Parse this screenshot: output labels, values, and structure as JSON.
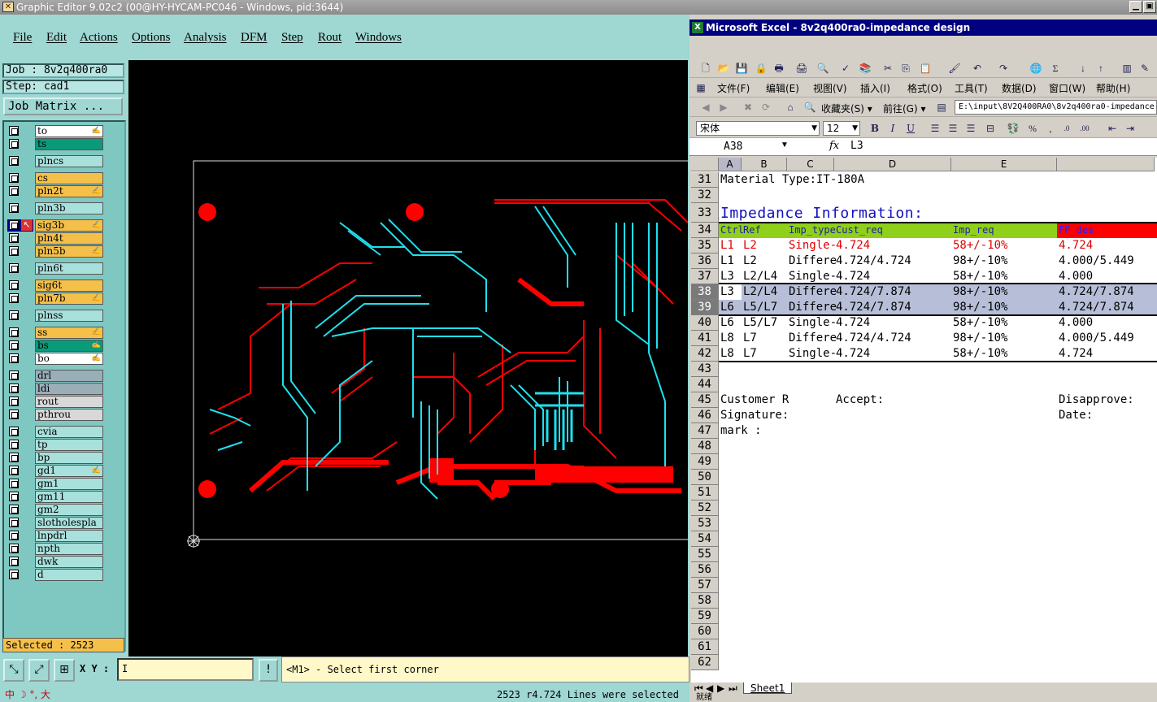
{
  "window": {
    "title": "Graphic Editor 9.02c2 (00@HY-HYCAM-PC046 - Windows, pid:3644)"
  },
  "menu": [
    "File",
    "Edit",
    "Actions",
    "Options",
    "Analysis",
    "DFM",
    "Step",
    "Rout",
    "Windows"
  ],
  "job": {
    "job": "Job : 8v2q400ra0",
    "step": "Step: cad1",
    "matrix": "Job Matrix ..."
  },
  "layers": [
    {
      "name": "to",
      "color": "#ffffff",
      "mark": "✍"
    },
    {
      "name": "ts",
      "color": "#0a9a7a",
      "mark": ""
    },
    {
      "name": "plncs",
      "color": "#a8e0dc",
      "mark": ""
    },
    {
      "name": "cs",
      "color": "#f5c04a",
      "mark": ""
    },
    {
      "name": "pln2t",
      "color": "#f5c04a",
      "mark": "✍"
    },
    {
      "name": "pln3b",
      "color": "#a8e0dc",
      "mark": ""
    },
    {
      "name": "sig3b",
      "color": "#f5c04a",
      "mark": "✍"
    },
    {
      "name": "pln4t",
      "color": "#f5c04a",
      "mark": ""
    },
    {
      "name": "pln5b",
      "color": "#f5c04a",
      "mark": "✍"
    },
    {
      "name": "pln6t",
      "color": "#a8e0dc",
      "mark": ""
    },
    {
      "name": "sig6t",
      "color": "#f5c04a",
      "mark": ""
    },
    {
      "name": "pln7b",
      "color": "#f5c04a",
      "mark": "✍"
    },
    {
      "name": "plnss",
      "color": "#a8e0dc",
      "mark": ""
    },
    {
      "name": "ss",
      "color": "#f5c04a",
      "mark": "✍"
    },
    {
      "name": "bs",
      "color": "#0a9a7a",
      "mark": "✍"
    },
    {
      "name": "bo",
      "color": "#ffffff",
      "mark": "✍"
    },
    {
      "name": "drl",
      "color": "#9aaeb8",
      "mark": ""
    },
    {
      "name": "ldi",
      "color": "#9aaeb8",
      "mark": ""
    },
    {
      "name": "rout",
      "color": "#d8d8d8",
      "mark": ""
    },
    {
      "name": "pthrou",
      "color": "#d8d8d8",
      "mark": ""
    },
    {
      "name": "cvia",
      "color": "#a8e0dc",
      "mark": ""
    },
    {
      "name": "tp",
      "color": "#a8e0dc",
      "mark": ""
    },
    {
      "name": "bp",
      "color": "#a8e0dc",
      "mark": ""
    },
    {
      "name": "gd1",
      "color": "#a8e0dc",
      "mark": "✍"
    },
    {
      "name": "gm1",
      "color": "#a8e0dc",
      "mark": ""
    },
    {
      "name": "gm11",
      "color": "#a8e0dc",
      "mark": ""
    },
    {
      "name": "gm2",
      "color": "#a8e0dc",
      "mark": ""
    },
    {
      "name": "slotholespla",
      "color": "#a8e0dc",
      "mark": ""
    },
    {
      "name": "lnpdrl",
      "color": "#a8e0dc",
      "mark": ""
    },
    {
      "name": "npth",
      "color": "#a8e0dc",
      "mark": ""
    },
    {
      "name": "dwk",
      "color": "#a8e0dc",
      "mark": ""
    },
    {
      "name": "d",
      "color": "#a8e0dc",
      "mark": ""
    }
  ],
  "selected": "Selected : 2523",
  "bottom": {
    "xy_label": "X Y :",
    "message": "<M1> - Select first corner",
    "status": "2523 r4.724 Lines were selected",
    "ime": "中 ☽ °, 大"
  },
  "excel": {
    "title": "Microsoft Excel - 8v2q400ra0-impedance design",
    "menu": [
      "文件(F)",
      "编辑(E)",
      "视图(V)",
      "插入(I)",
      "格式(O)",
      "工具(T)",
      "数据(D)",
      "窗口(W)",
      "帮助(H)"
    ],
    "web": {
      "favorites": "收藏夹(S) ▾",
      "go": "前往(G) ▾",
      "path": "E:\\input\\8V2Q400RA0\\8v2q400ra0-impedance"
    },
    "font": {
      "name": "宋体",
      "size": "12"
    },
    "namebox": "A38",
    "fx": "fx",
    "formula": "L3",
    "columns": [
      {
        "label": "A",
        "w": 28
      },
      {
        "label": "B",
        "w": 56
      },
      {
        "label": "C",
        "w": 58
      },
      {
        "label": "D",
        "w": 144
      },
      {
        "label": "E",
        "w": 130
      },
      {
        "label": "",
        "w": 120
      }
    ],
    "rows": [
      {
        "n": "31",
        "cells": [
          {
            "t": "Material Type:IT-180A",
            "c": 0
          }
        ]
      },
      {
        "n": "32",
        "cells": []
      },
      {
        "n": "33",
        "cells": [
          {
            "t": "Impedance Information:",
            "c": 0,
            "big": true
          }
        ]
      },
      {
        "n": "34",
        "cells": [
          {
            "t": "Ctrl",
            "c": 0
          },
          {
            "t": "Ref",
            "c": 1
          },
          {
            "t": "Imp_type",
            "c": 2
          },
          {
            "t": "Cust_req",
            "c": 3
          },
          {
            "t": "Imp_req",
            "c": 4
          },
          {
            "t": "FP_des",
            "c": 5
          }
        ],
        "hdr": true
      },
      {
        "n": "35",
        "cells": [
          {
            "t": "L1",
            "c": 0
          },
          {
            "t": "L2",
            "c": 1
          },
          {
            "t": "Single-",
            "c": 2
          },
          {
            "t": "4.724",
            "c": 3
          },
          {
            "t": "58+/-10%",
            "c": 4
          },
          {
            "t": "4.724",
            "c": 5
          }
        ],
        "red": true
      },
      {
        "n": "36",
        "cells": [
          {
            "t": "L1",
            "c": 0
          },
          {
            "t": "L2",
            "c": 1
          },
          {
            "t": "Differe",
            "c": 2
          },
          {
            "t": "4.724/4.724",
            "c": 3
          },
          {
            "t": "98+/-10%",
            "c": 4
          },
          {
            "t": "4.000/5.449",
            "c": 5
          }
        ]
      },
      {
        "n": "37",
        "cells": [
          {
            "t": "L3",
            "c": 0
          },
          {
            "t": "L2/L4",
            "c": 1
          },
          {
            "t": "Single-",
            "c": 2
          },
          {
            "t": "4.724",
            "c": 3
          },
          {
            "t": "58+/-10%",
            "c": 4
          },
          {
            "t": "4.000",
            "c": 5
          }
        ]
      },
      {
        "n": "38",
        "cells": [
          {
            "t": "L3",
            "c": 0
          },
          {
            "t": "L2/L4",
            "c": 1
          },
          {
            "t": "Differe",
            "c": 2
          },
          {
            "t": "4.724/7.874",
            "c": 3
          },
          {
            "t": "98+/-10%",
            "c": 4
          },
          {
            "t": "4.724/7.874",
            "c": 5
          }
        ],
        "sel": true
      },
      {
        "n": "39",
        "cells": [
          {
            "t": "L6",
            "c": 0
          },
          {
            "t": "L5/L7",
            "c": 1
          },
          {
            "t": "Differe",
            "c": 2
          },
          {
            "t": "4.724/7.874",
            "c": 3
          },
          {
            "t": "98+/-10%",
            "c": 4
          },
          {
            "t": "4.724/7.874",
            "c": 5
          }
        ],
        "sel": true
      },
      {
        "n": "40",
        "cells": [
          {
            "t": "L6",
            "c": 0
          },
          {
            "t": "L5/L7",
            "c": 1
          },
          {
            "t": "Single-",
            "c": 2
          },
          {
            "t": "4.724",
            "c": 3
          },
          {
            "t": "58+/-10%",
            "c": 4
          },
          {
            "t": "4.000",
            "c": 5
          }
        ]
      },
      {
        "n": "41",
        "cells": [
          {
            "t": "L8",
            "c": 0
          },
          {
            "t": "L7",
            "c": 1
          },
          {
            "t": "Differe",
            "c": 2
          },
          {
            "t": "4.724/4.724",
            "c": 3
          },
          {
            "t": "98+/-10%",
            "c": 4
          },
          {
            "t": "4.000/5.449",
            "c": 5
          }
        ]
      },
      {
        "n": "42",
        "cells": [
          {
            "t": "L8",
            "c": 0
          },
          {
            "t": "L7",
            "c": 1
          },
          {
            "t": "Single-",
            "c": 2
          },
          {
            "t": "4.724",
            "c": 3
          },
          {
            "t": "58+/-10%",
            "c": 4
          },
          {
            "t": "4.724",
            "c": 5
          }
        ]
      },
      {
        "n": "43",
        "cells": []
      },
      {
        "n": "44",
        "cells": []
      },
      {
        "n": "45",
        "cells": [
          {
            "t": "Customer R",
            "c": 0
          },
          {
            "t": "Accept:",
            "c": 3
          },
          {
            "t": "Disapprove:",
            "c": 5
          }
        ]
      },
      {
        "n": "46",
        "cells": [
          {
            "t": "Signature:",
            "c": 0
          },
          {
            "t": "Date:",
            "c": 5
          }
        ]
      },
      {
        "n": "47",
        "cells": [
          {
            "t": "mark :",
            "c": 0
          }
        ]
      },
      {
        "n": "48",
        "cells": []
      },
      {
        "n": "49",
        "cells": []
      },
      {
        "n": "50",
        "cells": []
      },
      {
        "n": "51",
        "cells": []
      },
      {
        "n": "52",
        "cells": []
      },
      {
        "n": "53",
        "cells": []
      },
      {
        "n": "54",
        "cells": []
      },
      {
        "n": "55",
        "cells": []
      },
      {
        "n": "56",
        "cells": []
      },
      {
        "n": "57",
        "cells": []
      },
      {
        "n": "58",
        "cells": []
      },
      {
        "n": "59",
        "cells": []
      },
      {
        "n": "60",
        "cells": []
      },
      {
        "n": "61",
        "cells": []
      },
      {
        "n": "62",
        "cells": []
      }
    ],
    "sheet_tab": "Sheet1",
    "status": "就绪"
  }
}
